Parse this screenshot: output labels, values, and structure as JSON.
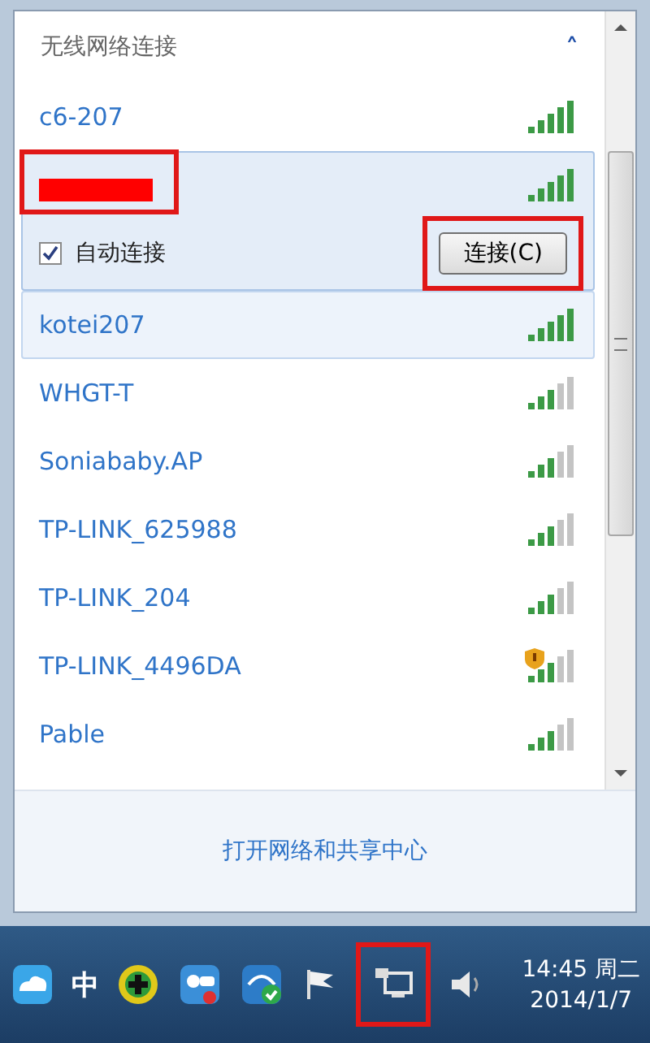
{
  "panel": {
    "title": "无线网络连接",
    "collapse_glyph": "˄"
  },
  "networks": [
    {
      "name": "c6-207",
      "kind": "strong",
      "warning": false,
      "expanded": false,
      "hover": false
    },
    {
      "redacted": true,
      "annotated": true,
      "kind": "strong",
      "warning": false,
      "expanded": true,
      "hover": false,
      "auto_connect": {
        "label": "自动连接",
        "checked": true
      },
      "connect_button": {
        "label": "连接(C)",
        "annotated": true
      }
    },
    {
      "name": "kotei207",
      "kind": "strong",
      "warning": false,
      "expanded": false,
      "hover": true
    },
    {
      "name": "WHGT-T",
      "kind": "fair",
      "warning": false,
      "expanded": false,
      "hover": false
    },
    {
      "name": "Soniababy.AP",
      "kind": "fair",
      "warning": false,
      "expanded": false,
      "hover": false
    },
    {
      "name": "TP-LINK_625988",
      "kind": "fair",
      "warning": false,
      "expanded": false,
      "hover": false
    },
    {
      "name": "TP-LINK_204",
      "kind": "fair",
      "warning": false,
      "expanded": false,
      "hover": false
    },
    {
      "name": "TP-LINK_4496DA",
      "kind": "fair",
      "warning": true,
      "expanded": false,
      "hover": false
    },
    {
      "name": "Pable",
      "kind": "fair",
      "warning": false,
      "expanded": false,
      "hover": false
    }
  ],
  "footer_link": "打开网络和共享中心",
  "taskbar": {
    "ime": "中",
    "network_icon_annotated": true,
    "time": "14:45 周二",
    "date": "2014/1/7"
  }
}
